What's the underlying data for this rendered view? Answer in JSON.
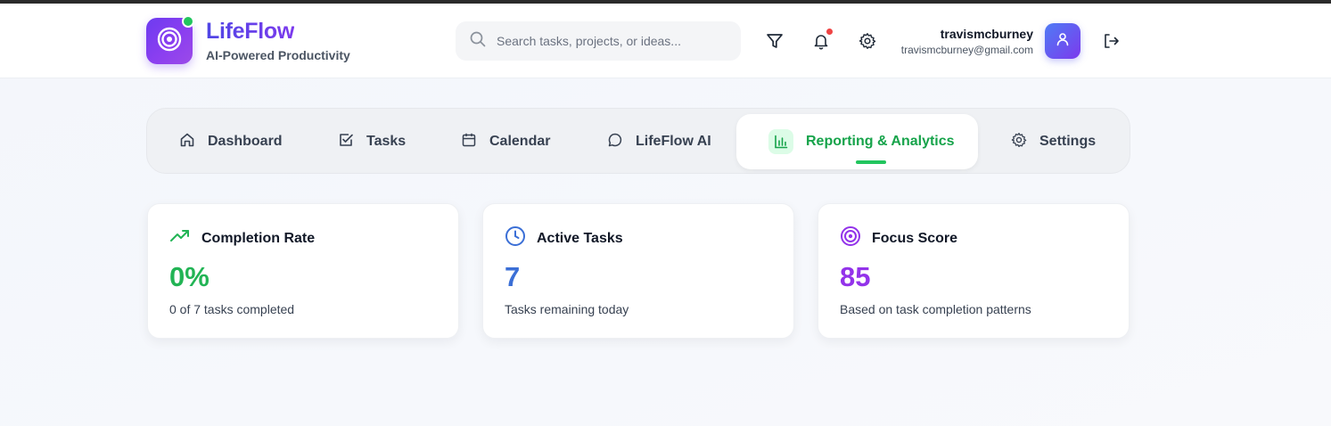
{
  "brand": {
    "name": "LifeFlow",
    "tagline": "AI-Powered Productivity"
  },
  "search": {
    "placeholder": "Search tasks, projects, or ideas..."
  },
  "header_icons": [
    "filter-icon",
    "bell-icon",
    "gear-icon",
    "logout-icon"
  ],
  "user": {
    "name": "travismcburney",
    "email": "travismcburney@gmail.com"
  },
  "nav": {
    "items": [
      {
        "label": "Dashboard",
        "icon": "home-icon"
      },
      {
        "label": "Tasks",
        "icon": "checkbox-icon"
      },
      {
        "label": "Calendar",
        "icon": "calendar-icon"
      },
      {
        "label": "LifeFlow AI",
        "icon": "chat-icon"
      },
      {
        "label": "Reporting & Analytics",
        "icon": "bar-chart-icon",
        "active": true
      },
      {
        "label": "Settings",
        "icon": "gear-icon"
      }
    ]
  },
  "cards": [
    {
      "title": "Completion Rate",
      "value": "0%",
      "description": "0 of 7 tasks completed",
      "icon": "trending-up-icon",
      "color": "#22b455"
    },
    {
      "title": "Active Tasks",
      "value": "7",
      "description": "Tasks remaining today",
      "icon": "clock-icon",
      "color": "#3b6fd6"
    },
    {
      "title": "Focus Score",
      "value": "85",
      "description": "Based on task completion patterns",
      "icon": "target-icon",
      "color": "#9333ea"
    }
  ],
  "colors": {
    "accent_green": "#16a34a",
    "brand_purple": "#7c3aed",
    "notification_red": "#ef4444",
    "online_green": "#22c55e"
  }
}
